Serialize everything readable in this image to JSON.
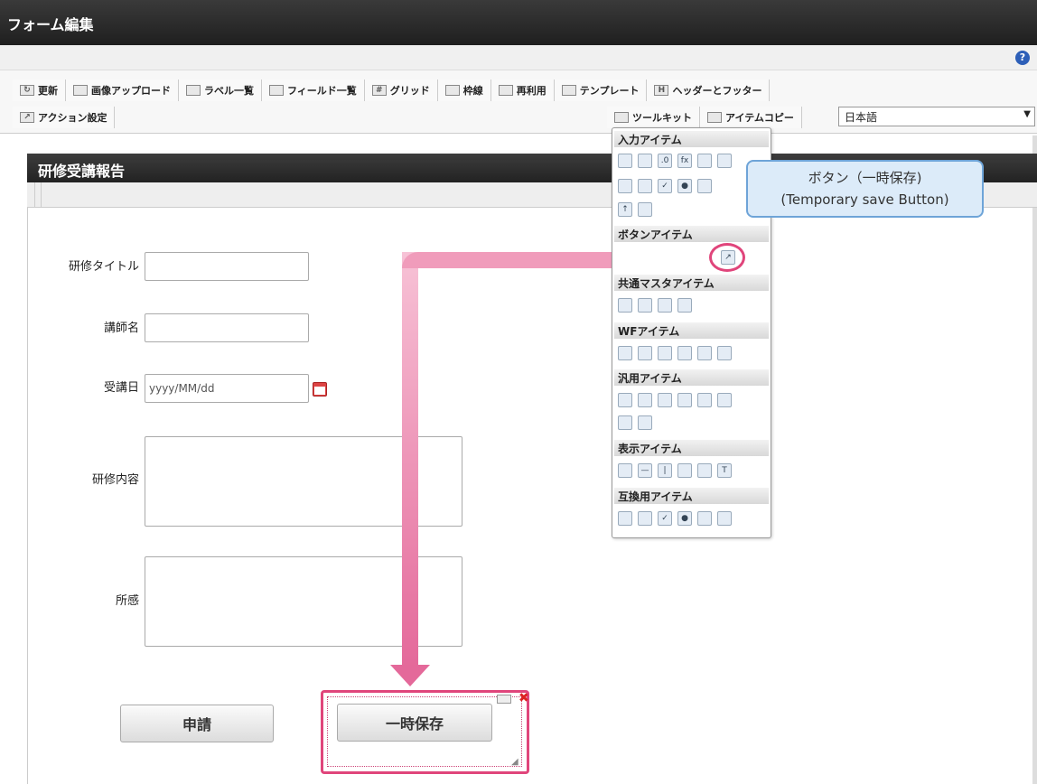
{
  "window": {
    "title": "フォーム編集"
  },
  "toolbar": {
    "row1": [
      "更新",
      "画像アップロード",
      "ラベル一覧",
      "フィールド一覧",
      "グリッド",
      "枠線",
      "再利用",
      "テンプレート",
      "ヘッダーとフッター"
    ],
    "row2_left": "アクション設定",
    "toolkit": "ツールキット",
    "item_copy": "アイテムコピー",
    "language": "日本語"
  },
  "form": {
    "title": "研修受講報告",
    "fields": {
      "title_label": "研修タイトル",
      "instructor_label": "講師名",
      "date_label": "受講日",
      "date_placeholder": "yyyy/MM/dd",
      "content_label": "研修内容",
      "impression_label": "所感"
    },
    "buttons": {
      "apply": "申請",
      "temp_save": "一時保存"
    }
  },
  "palette": {
    "sections": [
      "入力アイテム",
      "ボタンアイテム",
      "共通マスタアイテム",
      "WFアイテム",
      "汎用アイテム",
      "表示アイテム",
      "互換用アイテム"
    ]
  },
  "callout": {
    "line1": "ボタン（一時保存)",
    "line2": "(Temporary save Button)"
  }
}
